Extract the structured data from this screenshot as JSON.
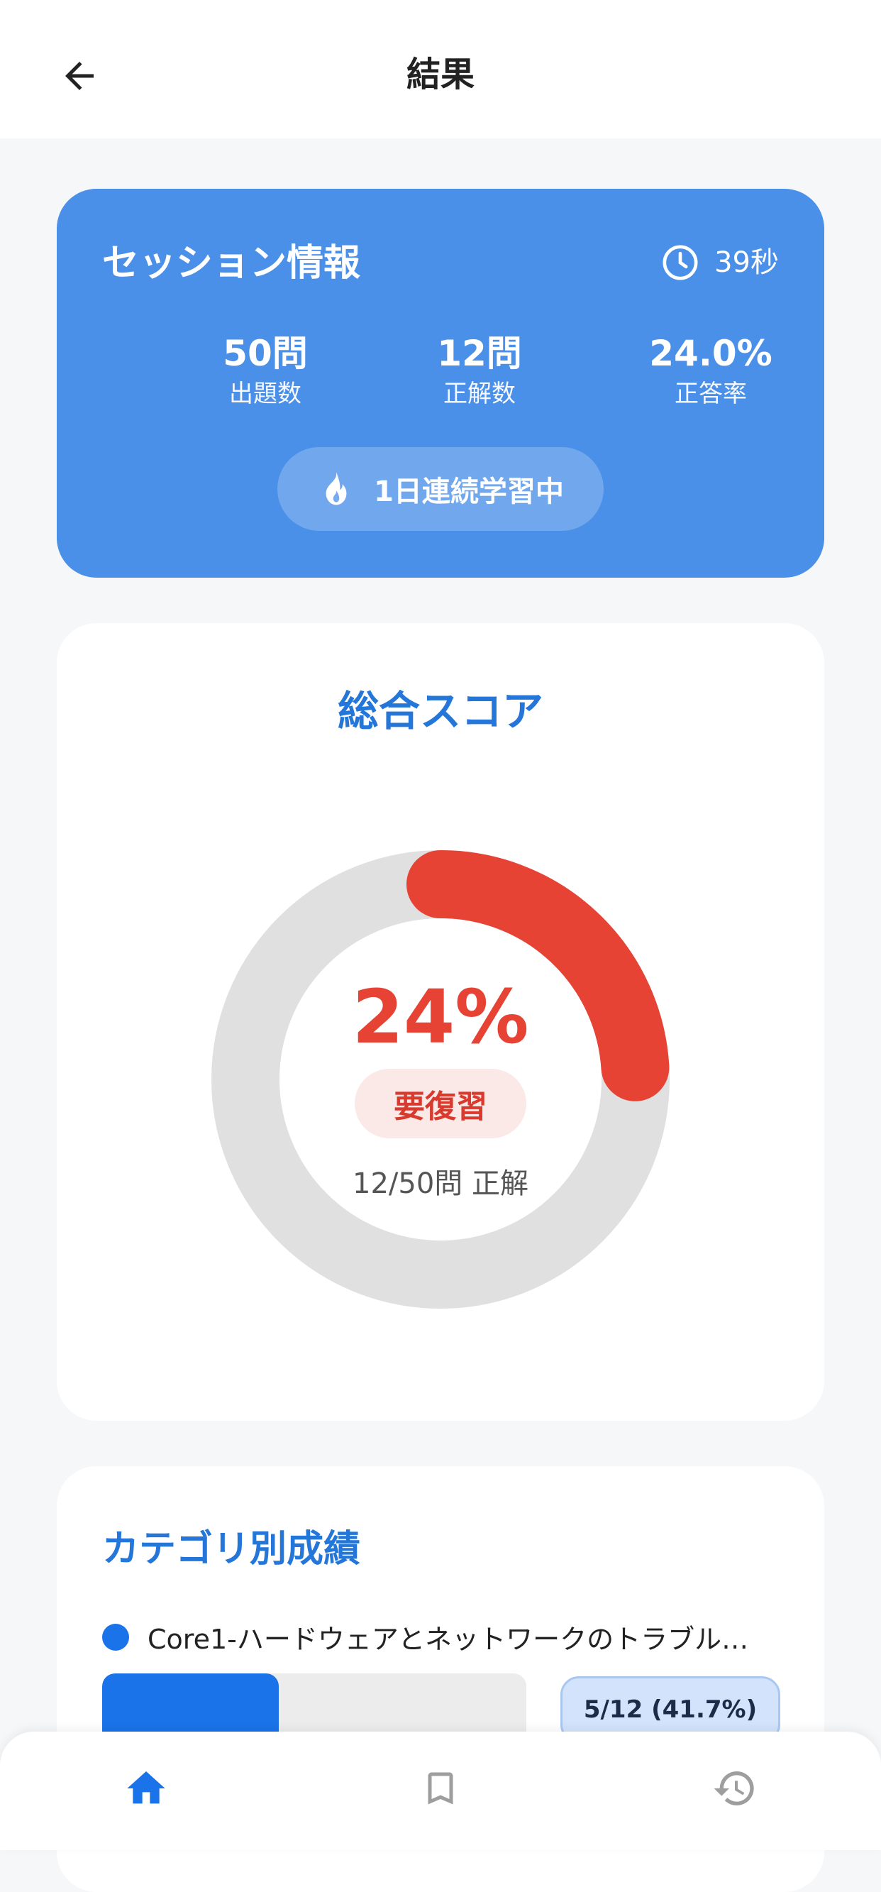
{
  "header": {
    "title": "結果",
    "back_icon": "arrow-left-icon"
  },
  "session": {
    "title": "セッション情報",
    "time_icon": "clock-icon",
    "time": "39秒",
    "stats": [
      {
        "value": "50問",
        "label": "出題数"
      },
      {
        "value": "12問",
        "label": "正解数"
      },
      {
        "value": "24.0%",
        "label": "正答率"
      }
    ],
    "streak_icon": "flame-icon",
    "streak": "1日連続学習中",
    "card_color": "#4a8fe8"
  },
  "score": {
    "title": "総合スコア",
    "percent_text": "24%",
    "progress": 0.24,
    "status": "要復習",
    "detail": "12/50問 正解",
    "ring_color": "#e64335",
    "track_color": "#e0e0e0"
  },
  "categories": {
    "title": "カテゴリ別成績",
    "items": [
      {
        "name": "Core1-ハードウェアとネットワークのトラブル…",
        "progress": 0.417,
        "score": "5/12 (41.7%)",
        "color": "#1a73e8"
      }
    ]
  },
  "nav": {
    "items": [
      {
        "icon": "home-icon",
        "active": true
      },
      {
        "icon": "bookmark-icon",
        "active": false
      },
      {
        "icon": "history-icon",
        "active": false
      }
    ],
    "active_color": "#1a73e8",
    "inactive_color": "#9e9e9e"
  }
}
